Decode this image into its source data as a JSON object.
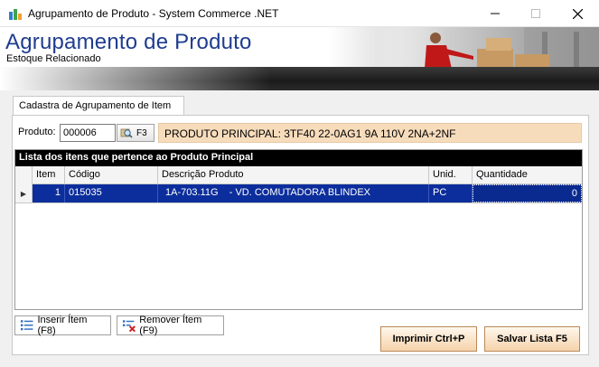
{
  "window": {
    "title": "Agrupamento de Produto - System Commerce .NET",
    "minimize_icon": "minimize-icon",
    "maximize_icon": "maximize-icon",
    "close_icon": "close-icon"
  },
  "banner": {
    "title": "Agrupamento de Produto",
    "subtitle": "Estoque Relacionado",
    "title_color": "#1f3d8f"
  },
  "tab": {
    "label": "Cadastra de Agrupamento de Item"
  },
  "product": {
    "label": "Produto:",
    "code": "000006",
    "lookup_button_label": "F3",
    "lookup_icon": "search-icon",
    "description": "PRODUTO PRINCIPAL: 3TF40 22-0AG1  9A 110V 2NA+2NF",
    "description_bg": "#f7dcbc"
  },
  "grid": {
    "caption": "Lista dos itens que pertence ao Produto Principal",
    "columns": [
      "Item",
      "Código",
      "Descrição Produto",
      "Unid.",
      "Quantidade"
    ],
    "rows": [
      {
        "item": "1",
        "codigo": "015035",
        "descricao": "1A-703.11G    - VD. COMUTADORA BLINDEX",
        "unid": "PC",
        "quantidade": "0"
      }
    ],
    "selection_color": "#0c2e9c"
  },
  "actions": {
    "insert_label": "Inserir Ítem (F8)",
    "remove_label": "Remover Ítem (F9)",
    "print_label": "Imprimir Ctrl+P",
    "save_label": "Salvar Lista F5"
  }
}
